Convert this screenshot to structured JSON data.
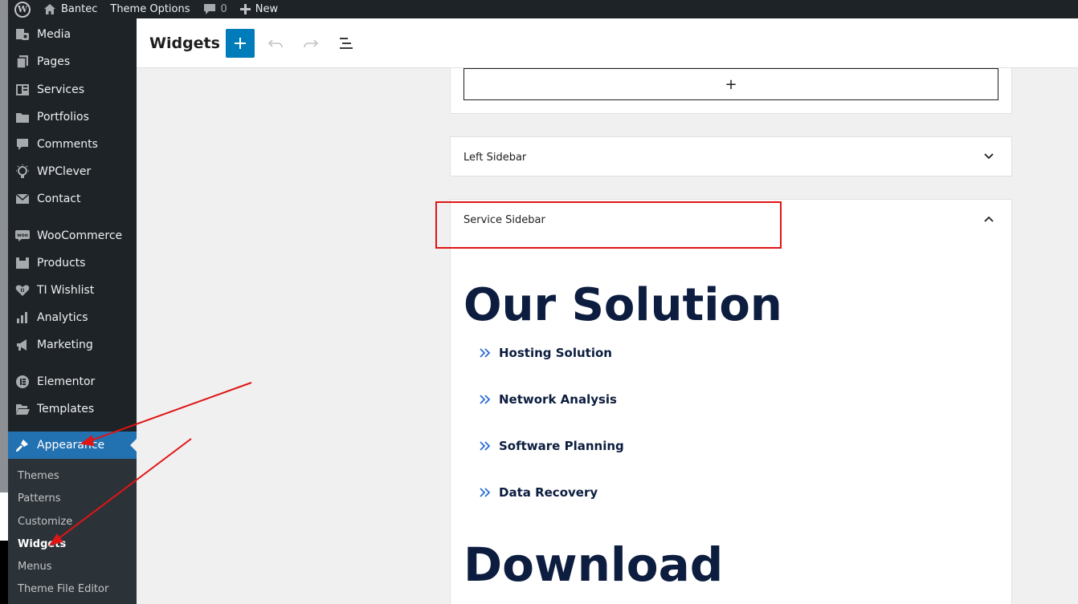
{
  "admin_bar": {
    "site_name": "Bantec",
    "theme_options": "Theme Options",
    "comments_count": "0",
    "new_label": "New"
  },
  "sidebar": {
    "items": [
      {
        "label": "Media",
        "icon": "media-icon"
      },
      {
        "label": "Pages",
        "icon": "pages-icon"
      },
      {
        "label": "Services",
        "icon": "services-icon"
      },
      {
        "label": "Portfolios",
        "icon": "folder-icon"
      },
      {
        "label": "Comments",
        "icon": "comment-icon"
      },
      {
        "label": "WPClever",
        "icon": "lightbulb-icon"
      },
      {
        "label": "Contact",
        "icon": "mail-icon"
      },
      {
        "label": "WooCommerce",
        "icon": "woo-icon"
      },
      {
        "label": "Products",
        "icon": "products-icon"
      },
      {
        "label": "TI Wishlist",
        "icon": "heart-icon"
      },
      {
        "label": "Analytics",
        "icon": "bar-chart-icon"
      },
      {
        "label": "Marketing",
        "icon": "megaphone-icon"
      },
      {
        "label": "Elementor",
        "icon": "elementor-icon"
      },
      {
        "label": "Templates",
        "icon": "folder-open-icon"
      },
      {
        "label": "Appearance",
        "icon": "paintbrush-icon"
      }
    ],
    "submenu": [
      "Themes",
      "Patterns",
      "Customize",
      "Widgets",
      "Menus",
      "Theme File Editor"
    ],
    "active_submenu": "Widgets"
  },
  "editor": {
    "title": "Widgets",
    "add_label": "+"
  },
  "widget_areas": {
    "appender_label": "+",
    "left_sidebar": "Left Sidebar",
    "service_sidebar": "Service Sidebar"
  },
  "content": {
    "heading_1": "Our Solution",
    "list": [
      "Hosting Solution",
      "Network Analysis",
      "Software Planning",
      "Data Recovery"
    ],
    "heading_2": "Download"
  },
  "colors": {
    "admin_bg": "#1d2327",
    "accent": "#2271b1",
    "heading": "#0c1d3f",
    "list_icon": "#2b6cd4",
    "annotation": "#e01515"
  }
}
